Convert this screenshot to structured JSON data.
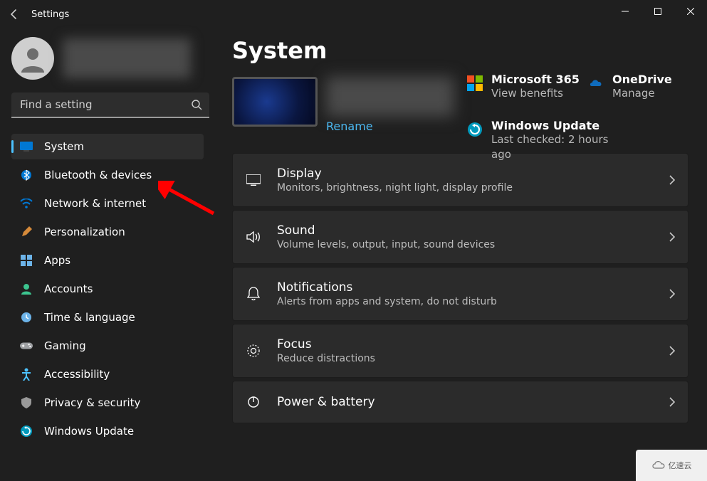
{
  "window": {
    "title": "Settings",
    "main_heading": "System"
  },
  "search": {
    "placeholder": "Find a setting"
  },
  "nav": [
    {
      "key": "system",
      "label": "System",
      "icon_color": "#0078d4",
      "selected": true
    },
    {
      "key": "bluetooth",
      "label": "Bluetooth & devices",
      "icon_color": "#0078d4",
      "selected": false
    },
    {
      "key": "network",
      "label": "Network & internet",
      "icon_color": "#0078d4",
      "selected": false
    },
    {
      "key": "personalization",
      "label": "Personalization",
      "icon_color": "#d68a3a",
      "selected": false
    },
    {
      "key": "apps",
      "label": "Apps",
      "icon_color": "#6cb3e8",
      "selected": false
    },
    {
      "key": "accounts",
      "label": "Accounts",
      "icon_color": "#3cc48f",
      "selected": false
    },
    {
      "key": "time",
      "label": "Time & language",
      "icon_color": "#6cb3e8",
      "selected": false
    },
    {
      "key": "gaming",
      "label": "Gaming",
      "icon_color": "#9ea0a3",
      "selected": false
    },
    {
      "key": "accessibility",
      "label": "Accessibility",
      "icon_color": "#4cc2ff",
      "selected": false
    },
    {
      "key": "privacy",
      "label": "Privacy & security",
      "icon_color": "#9a9a9a",
      "selected": false
    },
    {
      "key": "update",
      "label": "Windows Update",
      "icon_color": "#0099bc",
      "selected": false
    }
  ],
  "rename_label": "Rename",
  "services": {
    "m365": {
      "title": "Microsoft 365",
      "sub": "View benefits"
    },
    "onedrive": {
      "title": "OneDrive",
      "sub": "Manage"
    },
    "update": {
      "title": "Windows Update",
      "sub": "Last checked: 2 hours ago"
    }
  },
  "settings": [
    {
      "key": "display",
      "title": "Display",
      "sub": "Monitors, brightness, night light, display profile"
    },
    {
      "key": "sound",
      "title": "Sound",
      "sub": "Volume levels, output, input, sound devices"
    },
    {
      "key": "notifications",
      "title": "Notifications",
      "sub": "Alerts from apps and system, do not disturb"
    },
    {
      "key": "focus",
      "title": "Focus",
      "sub": "Reduce distractions"
    },
    {
      "key": "power",
      "title": "Power & battery",
      "sub": ""
    }
  ],
  "watermark": "亿速云"
}
